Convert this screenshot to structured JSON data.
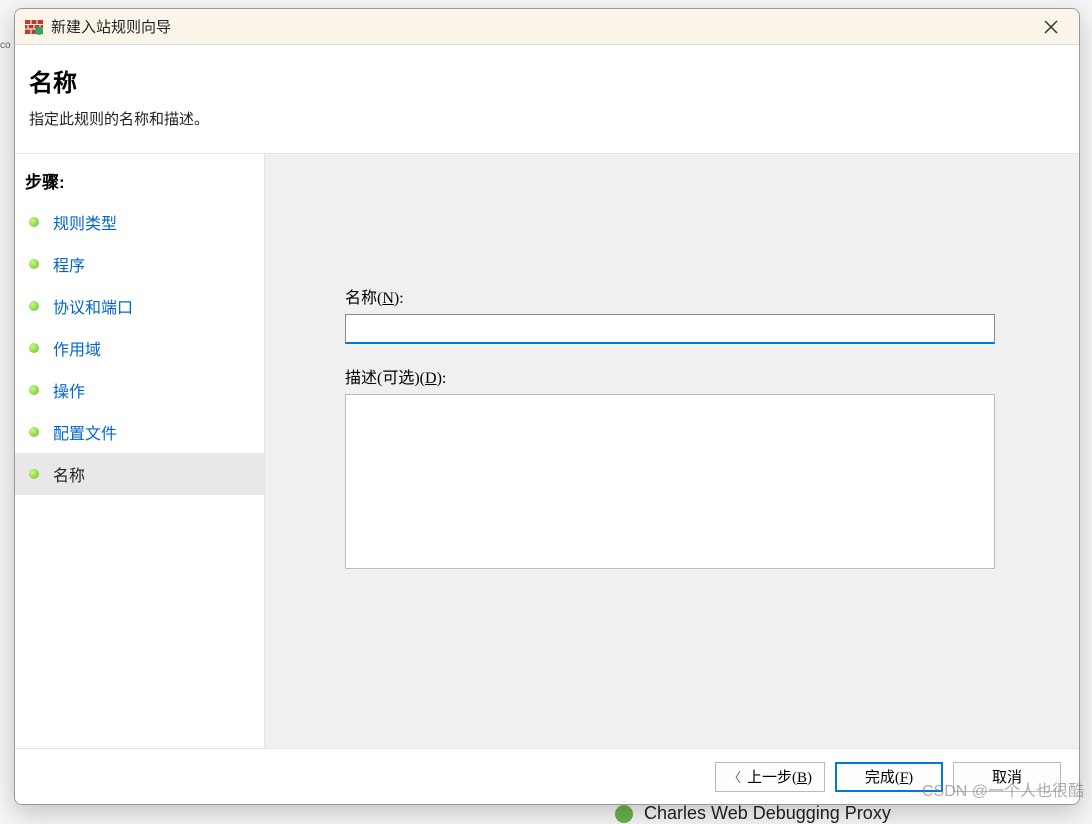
{
  "bg": {
    "left_fragment": "co",
    "charles_text": "Charles Web Debugging Proxy"
  },
  "watermark": "CSDN @一个人也很酷",
  "titlebar": {
    "title": "新建入站规则向导",
    "icon_name": "firewall-icon"
  },
  "header": {
    "title": "名称",
    "description": "指定此规则的名称和描述。"
  },
  "sidebar": {
    "header": "步骤:",
    "steps": [
      {
        "label": "规则类型",
        "active": false
      },
      {
        "label": "程序",
        "active": false
      },
      {
        "label": "协议和端口",
        "active": false
      },
      {
        "label": "作用域",
        "active": false
      },
      {
        "label": "操作",
        "active": false
      },
      {
        "label": "配置文件",
        "active": false
      },
      {
        "label": "名称",
        "active": true
      }
    ]
  },
  "form": {
    "name_label": "名称(N):",
    "name_value": "",
    "desc_label": "描述(可选)(D):",
    "desc_value": ""
  },
  "footer": {
    "back": "上一步(B)",
    "finish": "完成(F)",
    "cancel": "取消"
  }
}
